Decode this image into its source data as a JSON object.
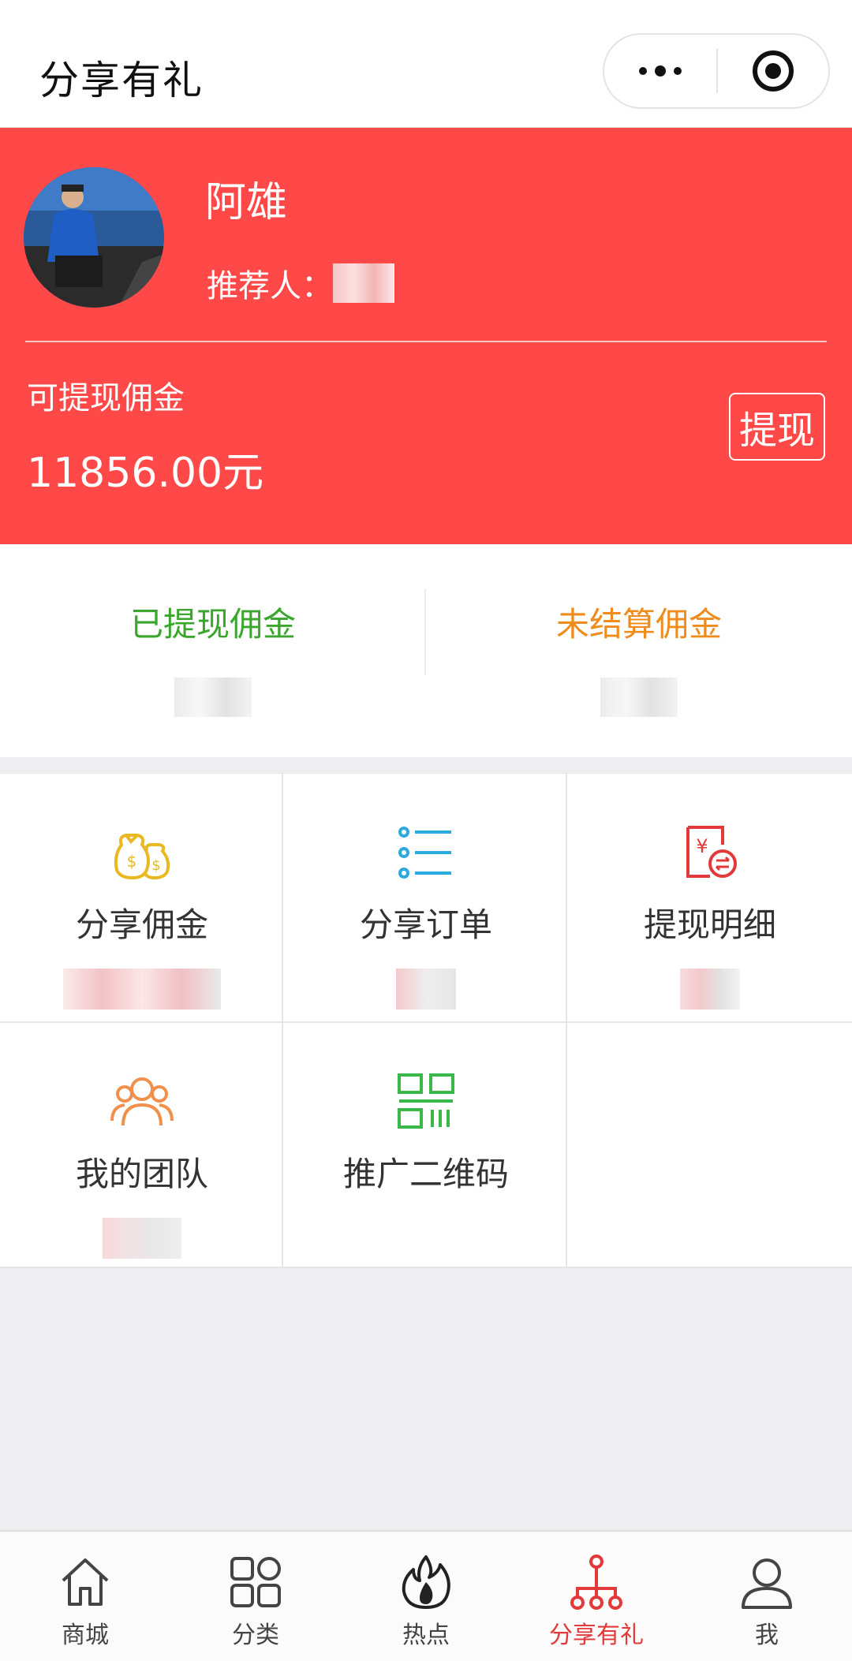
{
  "header": {
    "title": "分享有礼",
    "more_icon": "more-dots-icon",
    "close_icon": "target-circle-icon"
  },
  "profile": {
    "name": "阿雄",
    "referrer_label": "推荐人：",
    "withdrawable_label": "可提现佣金",
    "withdrawable_amount": "11856.00元",
    "withdraw_button": "提现"
  },
  "summary": {
    "withdrawn_label": "已提现佣金",
    "unsettled_label": "未结算佣金"
  },
  "grid": {
    "items": [
      {
        "label": "分享佣金",
        "icon": "money-bags-icon"
      },
      {
        "label": "分享订单",
        "icon": "list-icon"
      },
      {
        "label": "提现明细",
        "icon": "exchange-receipt-icon"
      },
      {
        "label": "我的团队",
        "icon": "team-icon"
      },
      {
        "label": "推广二维码",
        "icon": "qrcode-icon"
      }
    ]
  },
  "tabbar": {
    "items": [
      {
        "label": "商城",
        "icon": "home-icon",
        "active": false
      },
      {
        "label": "分类",
        "icon": "category-icon",
        "active": false
      },
      {
        "label": "热点",
        "icon": "fire-icon",
        "active": false
      },
      {
        "label": "分享有礼",
        "icon": "share-tree-icon",
        "active": true
      },
      {
        "label": "我",
        "icon": "user-icon",
        "active": false
      }
    ]
  },
  "colors": {
    "brand_red": "#ff4949",
    "green_label": "#3aa62c",
    "orange_label": "#ee8d1e",
    "active_tab": "#e23a3a"
  }
}
